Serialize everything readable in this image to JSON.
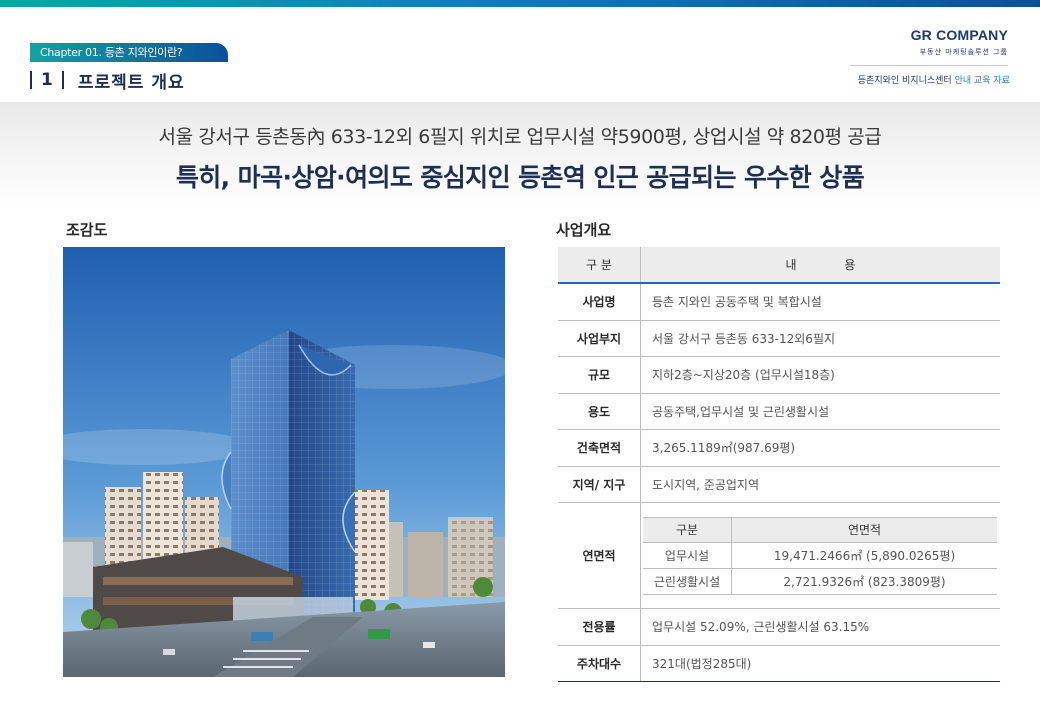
{
  "header": {
    "chapter": "Chapter 01. 등촌 지와인이란?",
    "section_number": "1",
    "section_title": "프로젝트 개요"
  },
  "brand": {
    "name": "GR COMPANY",
    "subtitle": "부동산 마케팅솔루션 그룹",
    "note_prefix": "등촌지와인 비지니스센터",
    "note_highlight": "안내 교육 자료"
  },
  "headline": {
    "line1": "서울 강서구 등촌동內 633-12외 6필지 위치로 업무시설 약5900평, 상업시설 약 820평 공급",
    "line2": "특히, 마곡·상암·여의도 중심지인 등촌역 인근 공급되는 우수한 상품"
  },
  "left_panel": {
    "title": "조감도"
  },
  "right_panel": {
    "title": "사업개요",
    "table_header": {
      "key": "구 분",
      "value": "내 용"
    },
    "rows": [
      {
        "key": "사업명",
        "value": "등촌 지와인 공동주택 및 복합시설"
      },
      {
        "key": "사업부지",
        "value": "서울 강서구 등촌동 633-12외6필지"
      },
      {
        "key": "규모",
        "value": "지하2층~지상20층 (업무시설18층)"
      },
      {
        "key": "용도",
        "value": "공동주택,업무시설 및 근린생활시설"
      },
      {
        "key": "건축면적",
        "value": "3,265.1189㎡(987.69평)"
      },
      {
        "key": "지역/ 지구",
        "value": "도시지역, 준공업지역"
      }
    ],
    "area": {
      "key": "연면적",
      "sub_header": {
        "c1": "구분",
        "c2": "연면적"
      },
      "sub_rows": [
        {
          "c1": "업무시설",
          "c2": "19,471.2466㎡ (5,890.0265평)"
        },
        {
          "c1": "근린생활시설",
          "c2": "2,721.9326㎡ (823.3809평)"
        }
      ]
    },
    "rows_after": [
      {
        "key": "전용률",
        "value": "업무시설 52.09%, 근린생활시설 63.15%"
      },
      {
        "key": "주차대수",
        "value": "321대(법정285대)"
      }
    ]
  }
}
